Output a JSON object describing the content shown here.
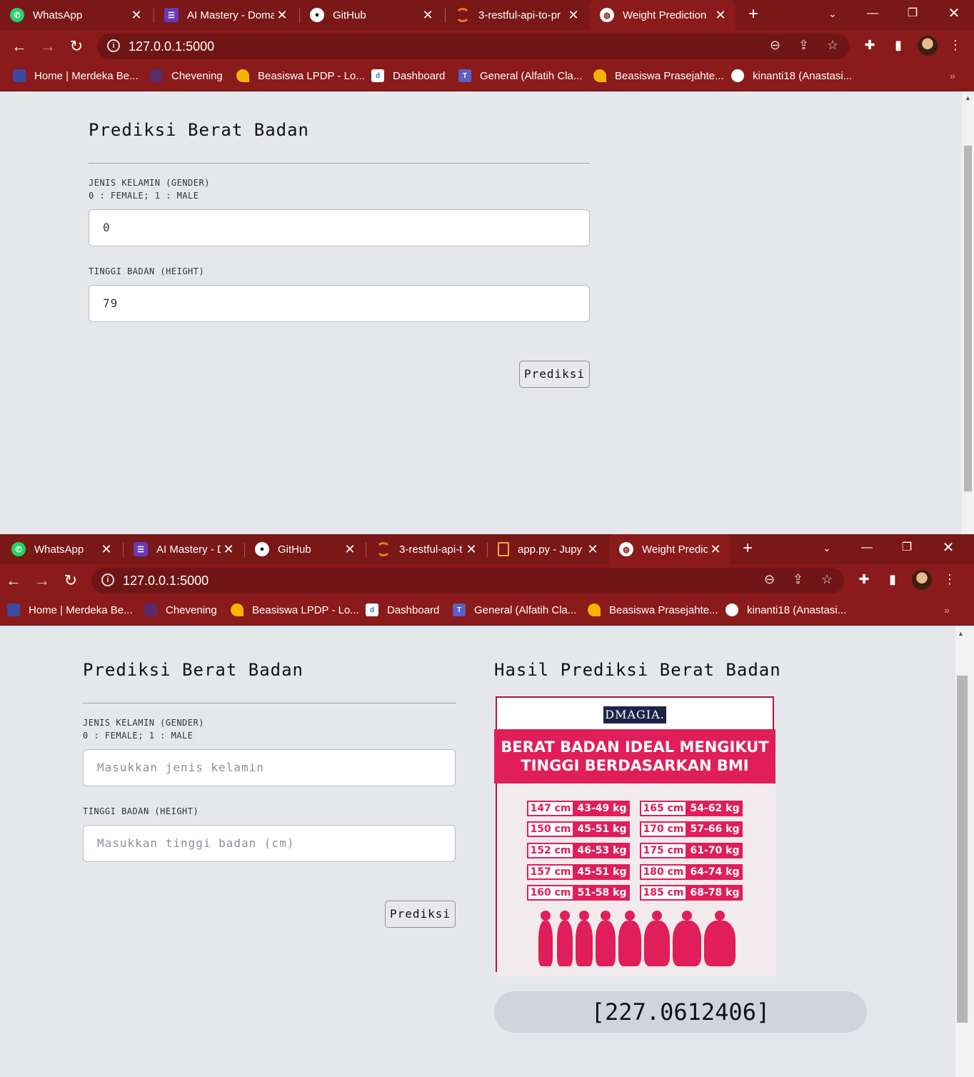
{
  "windows": [
    {
      "tabs": [
        {
          "icon": "whatsapp-icon",
          "title": "WhatsApp"
        },
        {
          "icon": "form-icon",
          "title": "AI Mastery - Doma"
        },
        {
          "icon": "github-icon",
          "title": "GitHub"
        },
        {
          "icon": "jupyter-icon",
          "title": "3-restful-api-to-pr"
        },
        {
          "icon": "globe-icon",
          "title": "Weight Prediction",
          "active": true
        }
      ],
      "url": "127.0.0.1:5000",
      "bookmarks": [
        {
          "icon": "merdeka-icon",
          "label": "Home | Merdeka Be..."
        },
        {
          "icon": "chevening-icon",
          "label": "Chevening"
        },
        {
          "icon": "lpdp-icon",
          "label": "Beasiswa LPDP - Lo..."
        },
        {
          "icon": "dashboard-icon",
          "label": "Dashboard"
        },
        {
          "icon": "teams-icon",
          "label": "General (Alfatih Cla..."
        },
        {
          "icon": "lpdp-icon",
          "label": "Beasiswa Prasejahte..."
        },
        {
          "icon": "github-icon",
          "label": "kinanti18 (Anastasi..."
        }
      ],
      "form": {
        "title": "Prediksi Berat Badan",
        "gender_label": "JENIS KELAMIN (GENDER)",
        "gender_hint": "0 : FEMALE; 1 : MALE",
        "gender_value": "0",
        "height_label": "TINGGI BADAN (HEIGHT)",
        "height_value": "79",
        "submit_label": "Prediksi"
      }
    },
    {
      "tabs": [
        {
          "icon": "whatsapp-icon",
          "title": "WhatsApp"
        },
        {
          "icon": "form-icon",
          "title": "AI Mastery - D"
        },
        {
          "icon": "github-icon",
          "title": "GitHub"
        },
        {
          "icon": "jupyter-icon",
          "title": "3-restful-api-t"
        },
        {
          "icon": "file-icon",
          "title": "app.py - Jupy"
        },
        {
          "icon": "globe-icon",
          "title": "Weight Predic",
          "active": true
        }
      ],
      "url": "127.0.0.1:5000",
      "bookmarks": [
        {
          "icon": "merdeka-icon",
          "label": "Home | Merdeka Be..."
        },
        {
          "icon": "chevening-icon",
          "label": "Chevening"
        },
        {
          "icon": "lpdp-icon",
          "label": "Beasiswa LPDP - Lo..."
        },
        {
          "icon": "dashboard-icon",
          "label": "Dashboard"
        },
        {
          "icon": "teams-icon",
          "label": "General (Alfatih Cla..."
        },
        {
          "icon": "lpdp-icon",
          "label": "Beasiswa Prasejahte..."
        },
        {
          "icon": "github-icon",
          "label": "kinanti18 (Anastasi..."
        }
      ],
      "form": {
        "title": "Prediksi Berat Badan",
        "gender_label": "JENIS KELAMIN (GENDER)",
        "gender_hint": "0 : FEMALE; 1 : MALE",
        "gender_placeholder": "Masukkan jenis kelamin",
        "height_label": "TINGGI BADAN (HEIGHT)",
        "height_placeholder": "Masukkan tinggi badan (cm)",
        "submit_label": "Prediksi"
      },
      "result": {
        "title": "Hasil Prediksi Berat Badan",
        "poster": {
          "brand": "DMAGIA.",
          "headline_1": "BERAT BADAN IDEAL MENGIKUT",
          "headline_2": "TINGGI BERDASARKAN BMI",
          "rows": [
            {
              "h": "147 cm",
              "w": "43-49 kg"
            },
            {
              "h": "150 cm",
              "w": "45-51 kg"
            },
            {
              "h": "152 cm",
              "w": "46-53 kg"
            },
            {
              "h": "157 cm",
              "w": "45-51 kg"
            },
            {
              "h": "160 cm",
              "w": "51-58 kg"
            },
            {
              "h": "165 cm",
              "w": "54-62 kg"
            },
            {
              "h": "170 cm",
              "w": "57-66 kg"
            },
            {
              "h": "175 cm",
              "w": "61-70 kg"
            },
            {
              "h": "180 cm",
              "w": "64-74 kg"
            },
            {
              "h": "185 cm",
              "w": "68-78 kg"
            }
          ]
        },
        "value": "[227.0612406]"
      }
    }
  ],
  "colors": {
    "chrome": "#8b1a1a",
    "tabstrip": "#7a1717",
    "accent": "#e01e5a",
    "page": "#e5e7eb"
  }
}
